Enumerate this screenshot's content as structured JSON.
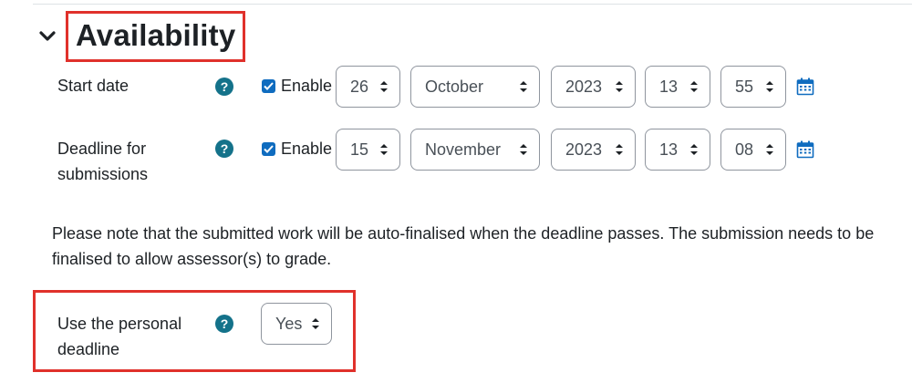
{
  "section": {
    "title": "Availability"
  },
  "fields": {
    "start_date": {
      "label": "Start date",
      "enable_label": "Enable",
      "enabled": true,
      "day": "26",
      "month": "October",
      "year": "2023",
      "hour": "13",
      "minute": "55"
    },
    "deadline": {
      "label_line1": "Deadline for",
      "label_line2": "submissions",
      "enable_label": "Enable",
      "enabled": true,
      "day": "15",
      "month": "November",
      "year": "2023",
      "hour": "13",
      "minute": "08"
    },
    "personal_deadline": {
      "label_line1": "Use the personal",
      "label_line2": "deadline",
      "value": "Yes"
    }
  },
  "note": "Please note that the submitted work will be auto-finalised when the deadline passes. The submission needs to be finalised to allow assessor(s) to grade.",
  "icons": {
    "help": "question-circle-icon",
    "calendar": "calendar-icon",
    "collapse": "chevron-down-icon",
    "select_arrows": "sort-arrows-icon",
    "checkbox": "checkmark-icon"
  },
  "colors": {
    "help_icon": "#14728a",
    "checkbox": "#0f6cbf",
    "calendar": "#0f6cbf",
    "highlight_box": "#e0312b"
  }
}
